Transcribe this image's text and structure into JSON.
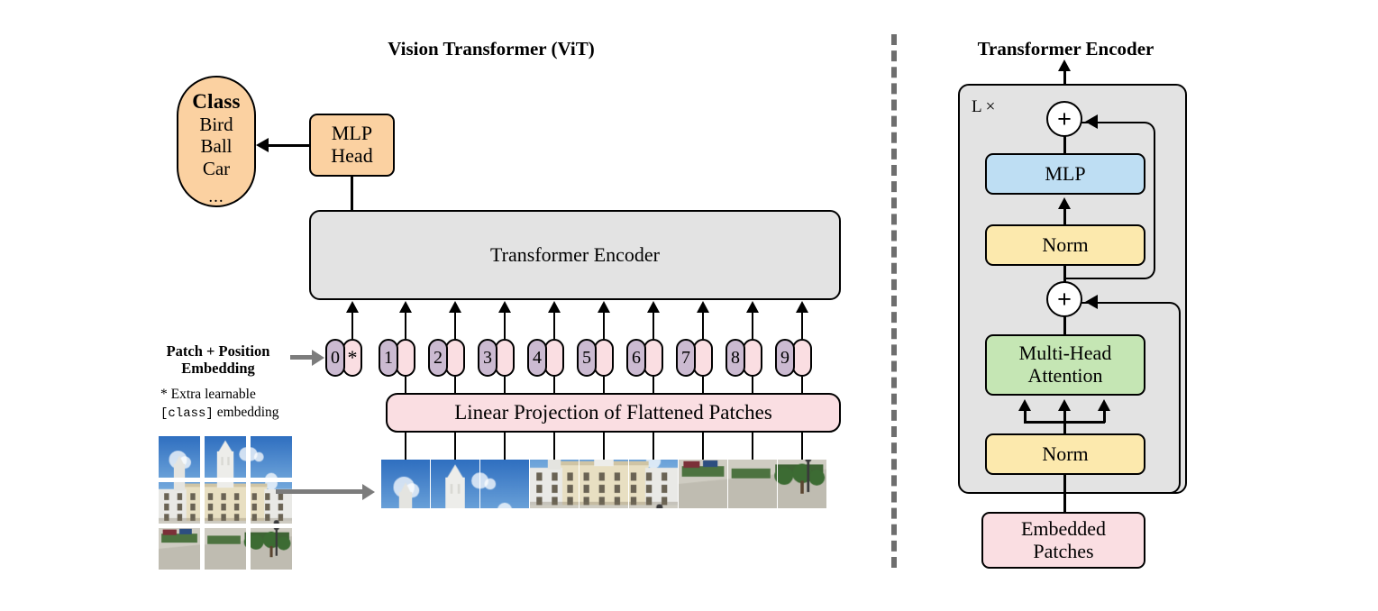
{
  "panels": {
    "left_title": "Vision Transformer (ViT)",
    "right_title": "Transformer Encoder"
  },
  "left": {
    "class_pill": {
      "heading": "Class",
      "items": [
        "Bird",
        "Ball",
        "Car"
      ],
      "ellipsis": "...",
      "color": "#fbd1a1"
    },
    "mlp_head": {
      "line1": "MLP",
      "line2": "Head",
      "color": "#fbd1a1"
    },
    "encoder_bar": {
      "label": "Transformer Encoder",
      "color": "#e3e3e3"
    },
    "linear_projection": {
      "label": "Linear Projection of Flattened Patches",
      "color": "#fadee2"
    },
    "embedding_label": {
      "line1": "Patch + Position",
      "line2": "Embedding"
    },
    "footnote": {
      "line1_prefix": "* Extra learnable",
      "line2_mono": "[class]",
      "line2_suffix": " embedding"
    },
    "tokens": [
      {
        "pos": "0",
        "emb": "*"
      },
      {
        "pos": "1",
        "emb": ""
      },
      {
        "pos": "2",
        "emb": ""
      },
      {
        "pos": "3",
        "emb": ""
      },
      {
        "pos": "4",
        "emb": ""
      },
      {
        "pos": "5",
        "emb": ""
      },
      {
        "pos": "6",
        "emb": ""
      },
      {
        "pos": "7",
        "emb": ""
      },
      {
        "pos": "8",
        "emb": ""
      },
      {
        "pos": "9",
        "emb": ""
      }
    ],
    "token_colors": {
      "position": "#cbbad1",
      "embedding": "#fadee2"
    },
    "source_image": {
      "description": "palace-photo-3x3-grid",
      "rows": 3,
      "cols": 3
    },
    "flattened_patches_count": 9
  },
  "right": {
    "repeat_label": "L ×",
    "add_symbol": "+",
    "blocks": {
      "mlp": {
        "label": "MLP",
        "color": "#bedef3"
      },
      "norm_top": {
        "label": "Norm",
        "color": "#fce9ad"
      },
      "attention": {
        "line1": "Multi-Head",
        "line2": "Attention",
        "color": "#c5e6b4"
      },
      "norm_bottom": {
        "label": "Norm",
        "color": "#fce9ad"
      },
      "embedded_patches": {
        "line1": "Embedded",
        "line2": "Patches",
        "color": "#fadee2"
      }
    },
    "outer_box_color": "#e3e3e3"
  },
  "divider": {
    "style": "dashed",
    "color": "#6e6e6e"
  }
}
